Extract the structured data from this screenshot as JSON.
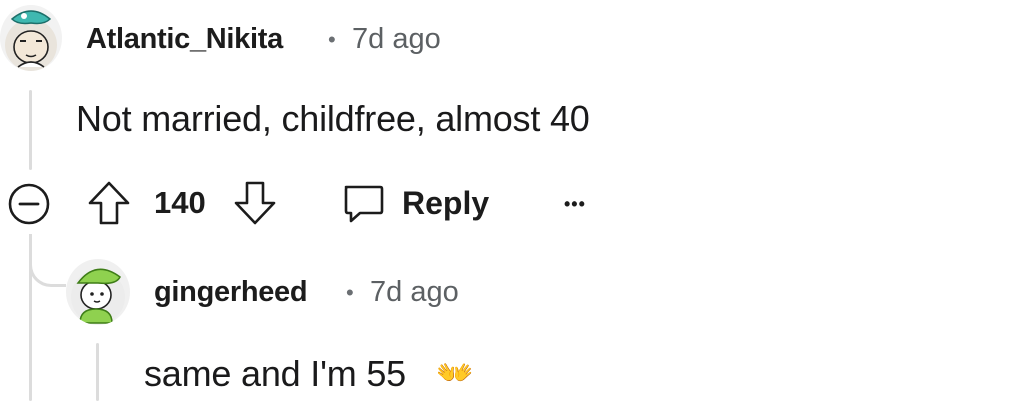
{
  "comments": [
    {
      "username": "Atlantic_Nikita",
      "separator": "•",
      "time": "7d ago",
      "body": "Not married, childfree, almost 40",
      "votes": "140",
      "reply_label": "Reply",
      "more_label": "•••"
    },
    {
      "username": "gingerheed",
      "separator": "•",
      "time": "7d ago",
      "body": "same and I'm 55",
      "emoji": "👐"
    }
  ],
  "colors": {
    "thread_line": "#dcdcdc",
    "text": "#1a1a1b",
    "meta": "#5c6063"
  }
}
